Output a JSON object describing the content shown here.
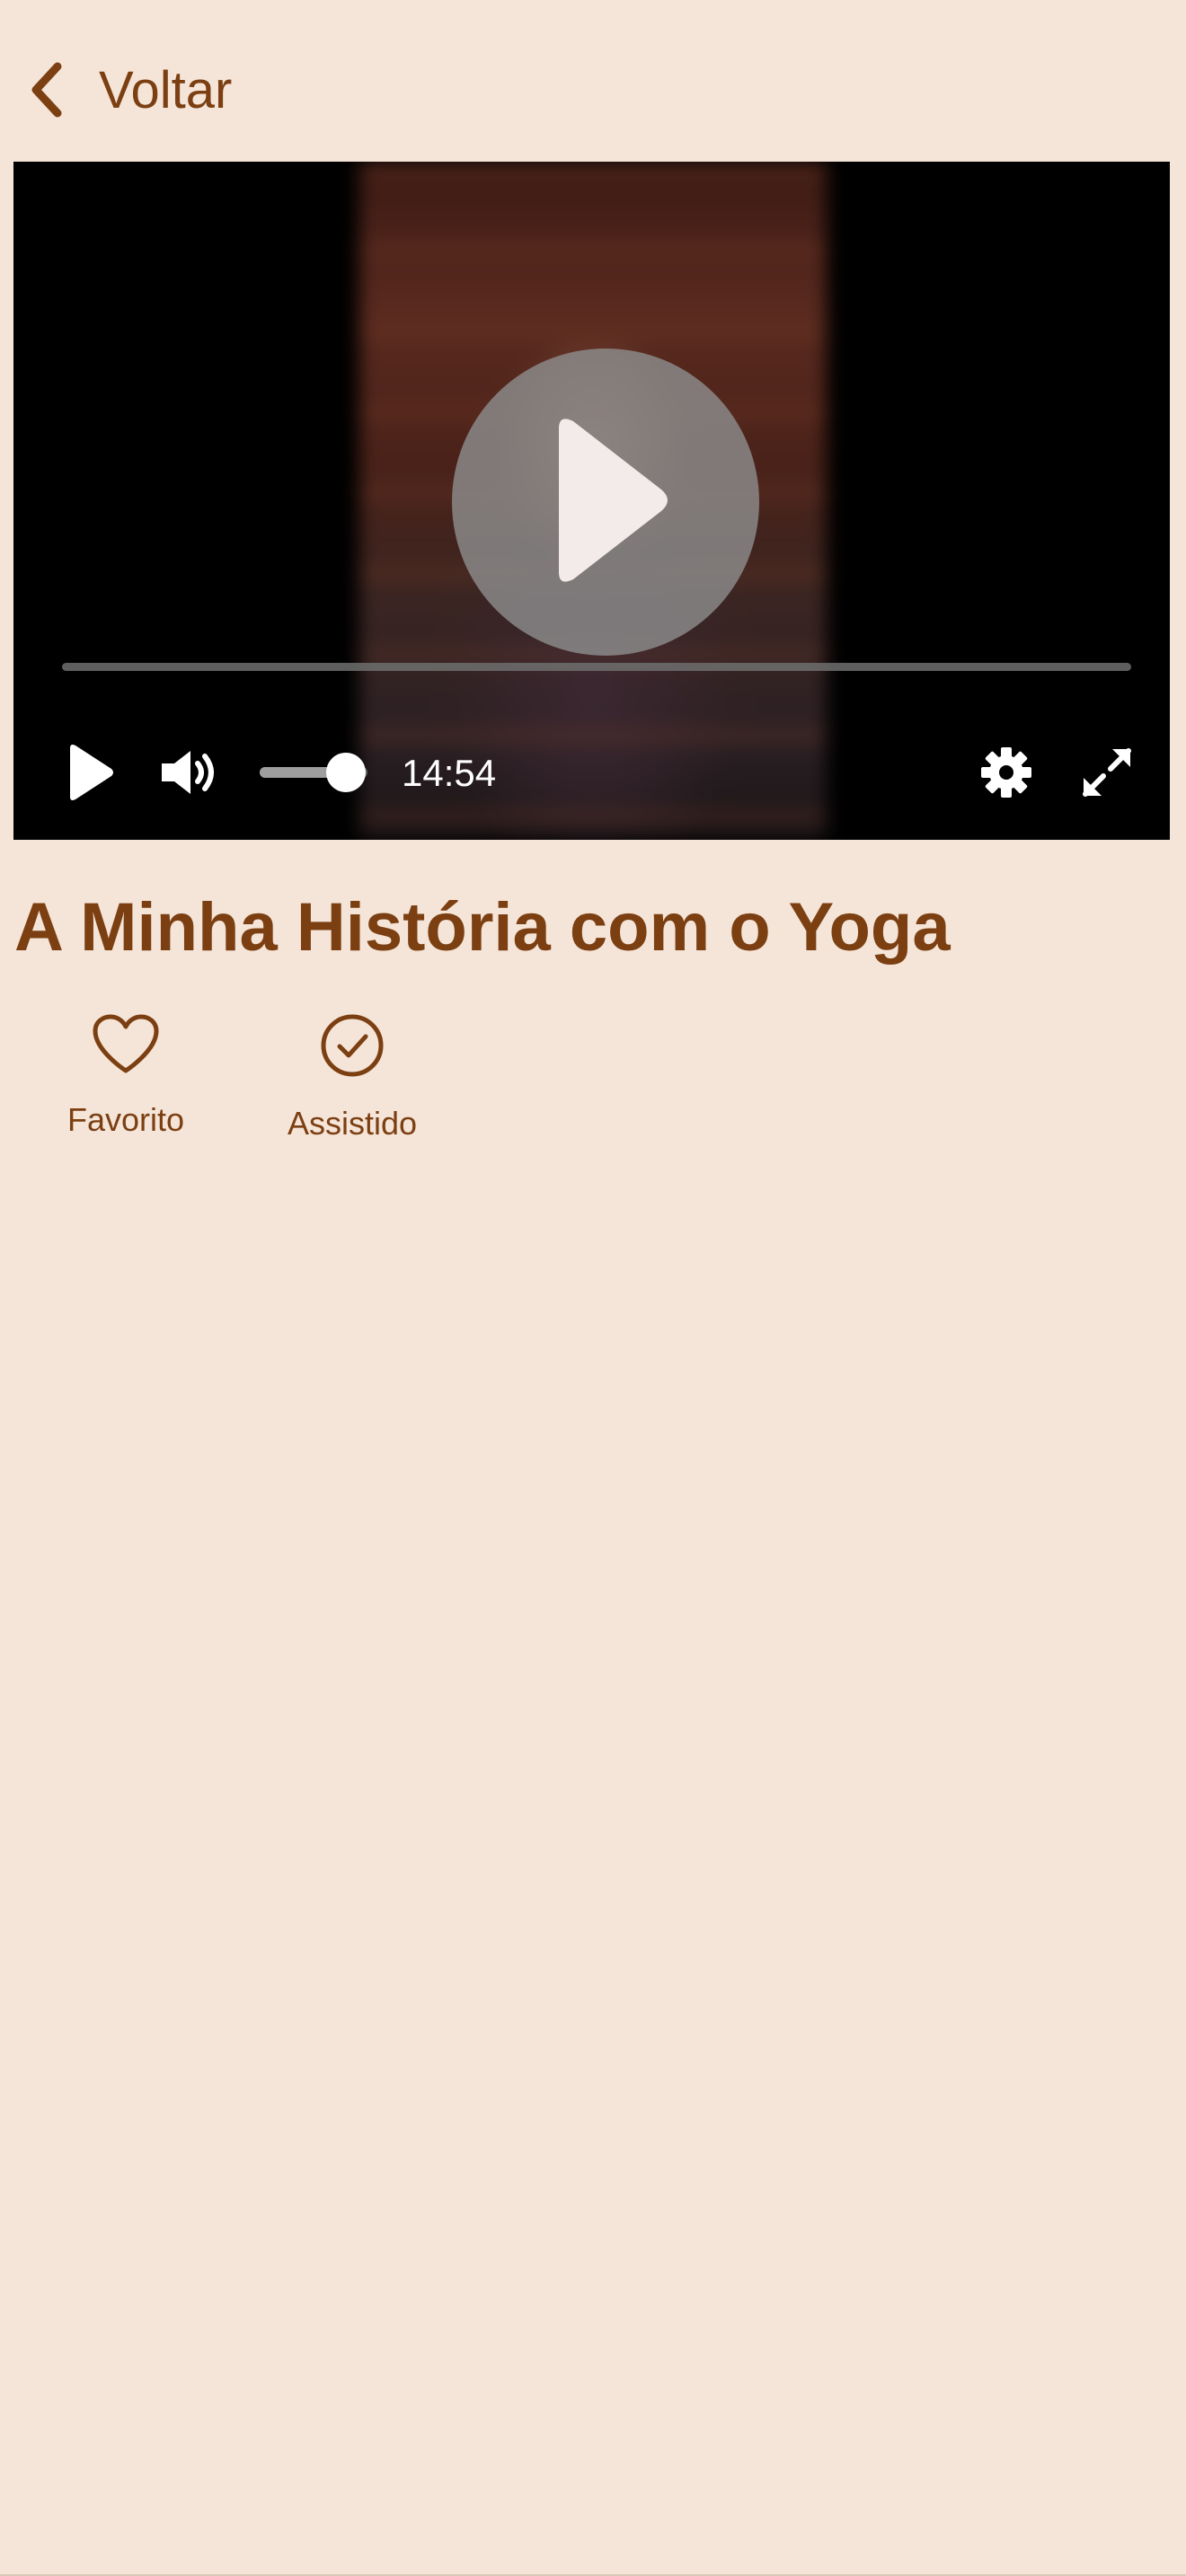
{
  "header": {
    "back_label": "Voltar"
  },
  "player": {
    "time_display": "14:54",
    "progress": 0.0,
    "volume": 0.8
  },
  "video": {
    "title": "A Minha História com o Yoga"
  },
  "actions": {
    "favorite_label": "Favorito",
    "watched_label": "Assistido"
  },
  "colors": {
    "background": "#f5e5d8",
    "accent": "#7b3f12",
    "player_background": "#000000"
  }
}
